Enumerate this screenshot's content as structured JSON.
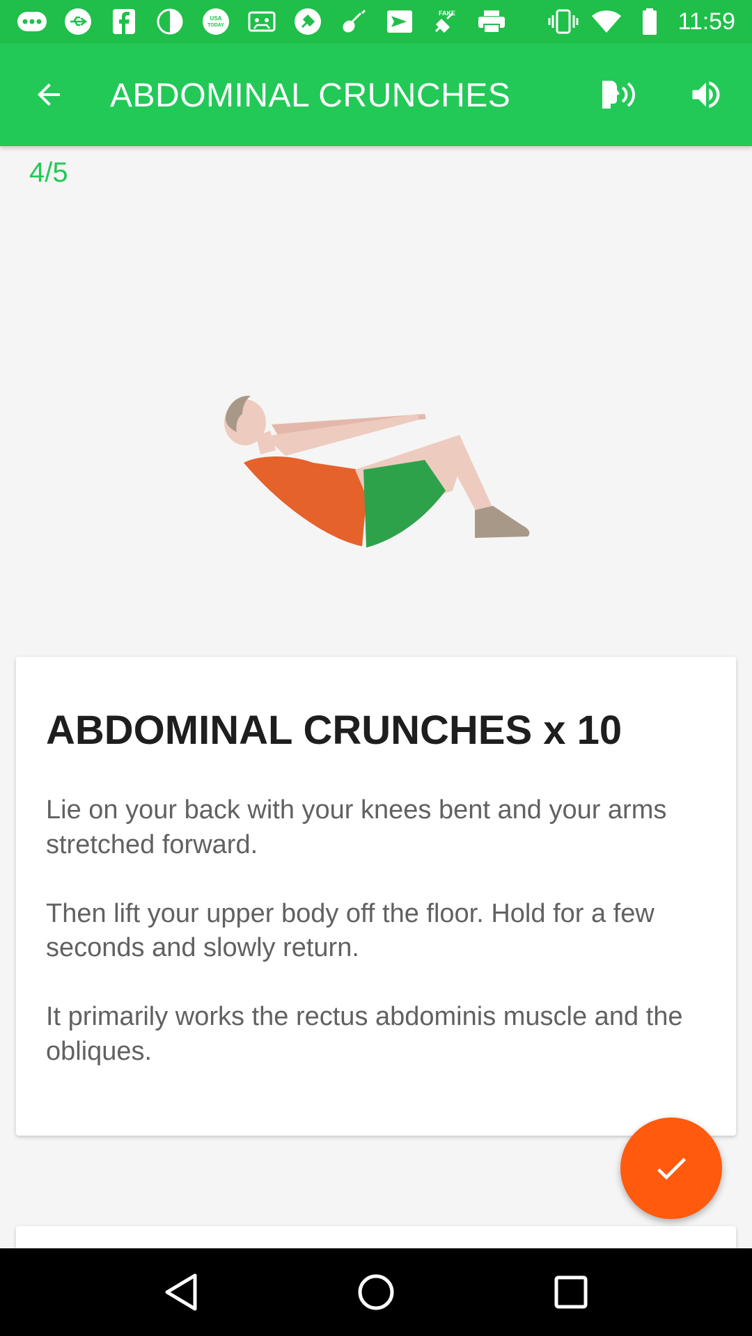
{
  "status_bar": {
    "time": "11:59",
    "icons": [
      "more-dots-icon",
      "usb-icon",
      "facebook-icon",
      "circle-half-icon",
      "usa-today-icon",
      "cassette-icon",
      "satellite-icon",
      "guitar-icon",
      "send-box-icon",
      "fake-gps-icon",
      "printer-icon",
      "vibrate-icon",
      "wifi-icon",
      "battery-icon"
    ],
    "usa_today_label": "USA TODAY",
    "fake_label": "FAKE"
  },
  "app_bar": {
    "title": "ABDOMINAL CRUNCHES",
    "back_icon": "arrow-back-icon",
    "voice_icon": "voice-guide-icon",
    "volume_icon": "volume-icon"
  },
  "progress": "4/5",
  "exercise": {
    "title": "ABDOMINAL CRUNCHES x 10",
    "paragraphs": [
      "Lie on your back with your knees bent and your arms stretched forward.",
      "Then lift your upper body off the floor. Hold for a few seconds and slowly return.",
      "It primarily works the rectus abdominis muscle and the obliques."
    ]
  },
  "fab": {
    "icon": "check-icon"
  },
  "nav_bar": {
    "icons": [
      "back-triangle-icon",
      "home-circle-icon",
      "recents-square-icon"
    ]
  },
  "colors": {
    "status_bar": "#1fbf4a",
    "app_bar": "#22c957",
    "accent_green": "#22c957",
    "fab": "#ff5a0e",
    "background": "#f5f5f5",
    "shirt": "#e5622b",
    "shorts": "#2ea24a",
    "skin": "#eecbbf"
  }
}
